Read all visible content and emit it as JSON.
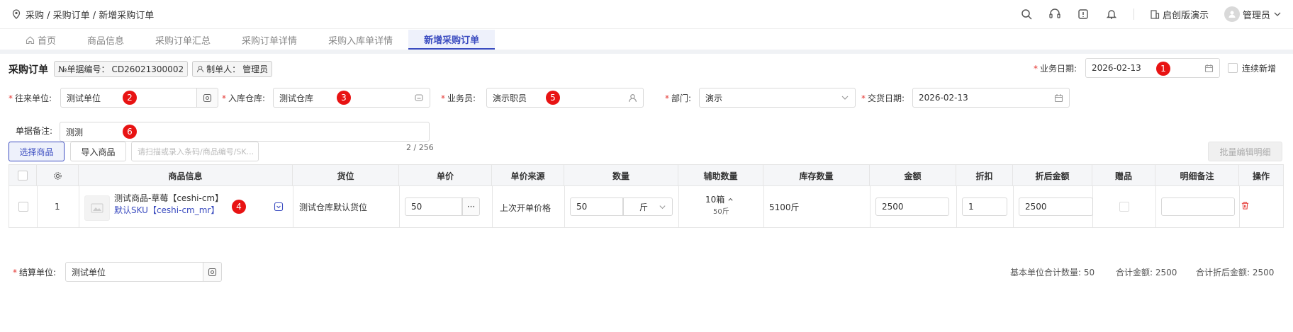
{
  "topbar": {
    "breadcrumb": "采购 / 采购订单 / 新增采购订单",
    "org_name": "启创版演示",
    "user_name": "管理员"
  },
  "tabs": [
    {
      "label": "首页"
    },
    {
      "label": "商品信息"
    },
    {
      "label": "采购订单汇总"
    },
    {
      "label": "采购订单详情"
    },
    {
      "label": "采购入库单详情"
    },
    {
      "label": "新增采购订单"
    }
  ],
  "header": {
    "title": "采购订单",
    "doc_no_label": "№单据编号：",
    "doc_no": "CD26021300002",
    "creator_label": "制单人：",
    "creator": "管理员",
    "business_date_label": "业务日期:",
    "business_date": "2026-02-13",
    "continuous_label": "连续新增"
  },
  "form": {
    "partner_label": "往来单位:",
    "partner_value": "测试单位",
    "warehouse_label": "入库仓库:",
    "warehouse_value": "测试仓库",
    "salesman_label": "业务员:",
    "salesman_value": "演示职员",
    "dept_label": "部门:",
    "dept_value": "演示",
    "delivery_label": "交货日期:",
    "delivery_value": "2026-02-13",
    "remark_label": "单据备注:",
    "remark_value": "测测",
    "remark_count": "2 / 256"
  },
  "badges": [
    "1",
    "2",
    "3",
    "4",
    "5",
    "6"
  ],
  "toolbar": {
    "select_goods": "选择商品",
    "import_goods": "导入商品",
    "scan_placeholder": "请扫描或录入条码/商品编号/SK...",
    "batch_edit": "批量编辑明细"
  },
  "table": {
    "columns": [
      "商品信息",
      "货位",
      "单价",
      "单价来源",
      "数量",
      "辅助数量",
      "库存数量",
      "金额",
      "折扣",
      "折后金额",
      "赠品",
      "明细备注",
      "操作"
    ],
    "row": {
      "index": "1",
      "goods_name": "测试商品-草莓【ceshi-cm】",
      "goods_sku": "默认SKU【ceshi-cm_mr】",
      "location": "测试仓库默认货位",
      "price": "50",
      "price_source": "上次开单价格",
      "qty": "50",
      "unit": "斤",
      "aux_qty": "10箱",
      "aux_qty_sub": "50斤",
      "stock": "5100斤",
      "amount": "2500",
      "discount": "1",
      "discounted_amount": "2500",
      "detail_remark": ""
    }
  },
  "footer": {
    "settle_label": "结算单位:",
    "settle_value": "测试单位",
    "total_qty_label": "基本单位合计数量:",
    "total_qty": "50",
    "total_amount_label": "合计金额:",
    "total_amount": "2500",
    "total_discounted_label": "合计折后金额:",
    "total_discounted": "2500"
  },
  "colors": {
    "accent": "#3b4cc0",
    "required": "#e53935",
    "badge": "#e81313"
  }
}
